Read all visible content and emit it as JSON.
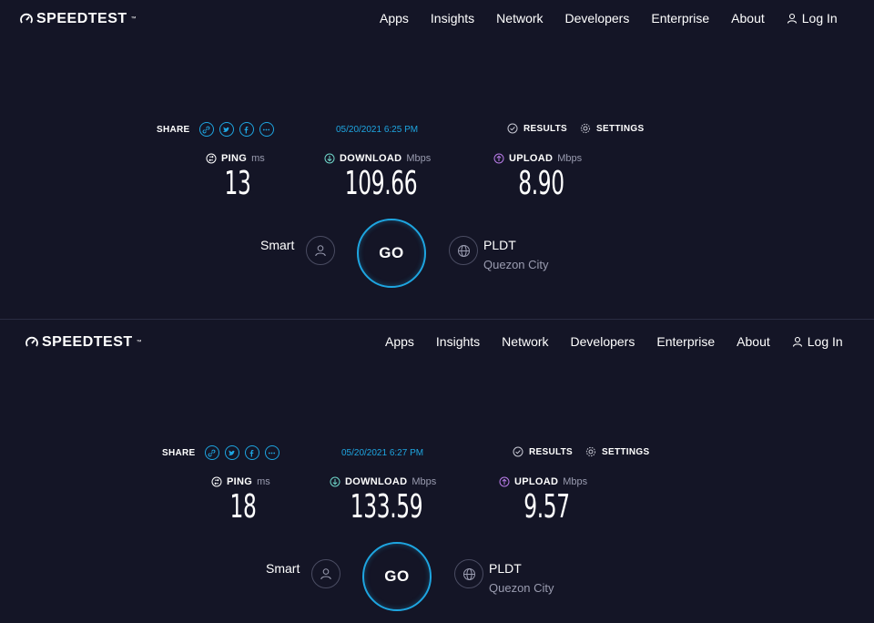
{
  "colors": {
    "background": "#141526",
    "accent_cyan": "#1ea5e0",
    "download_green": "#6fd6c9",
    "upload_purple": "#b97ce8",
    "muted": "#9a9cb0"
  },
  "icons": [
    "speedometer-icon",
    "user-icon",
    "link-icon",
    "twitter-icon",
    "facebook-icon",
    "more-icon",
    "check-circle-icon",
    "gear-icon",
    "ping-icon",
    "download-arrow-icon",
    "upload-arrow-icon",
    "globe-icon"
  ],
  "panels": [
    {
      "header": {
        "logo": "SPEEDTEST",
        "nav": [
          "Apps",
          "Insights",
          "Network",
          "Developers",
          "Enterprise",
          "About"
        ],
        "login": "Log In"
      },
      "share_label": "SHARE",
      "datetime": "05/20/2021 6:25 PM",
      "results_label": "RESULTS",
      "settings_label": "SETTINGS",
      "ping": {
        "label": "PING",
        "unit": "ms",
        "value": "13"
      },
      "download": {
        "label": "DOWNLOAD",
        "unit": "Mbps",
        "value": "109.66"
      },
      "upload": {
        "label": "UPLOAD",
        "unit": "Mbps",
        "value": "8.90"
      },
      "client_isp": "Smart",
      "go_label": "GO",
      "server": {
        "name": "PLDT",
        "location": "Quezon City"
      }
    },
    {
      "header": {
        "logo": "SPEEDTEST",
        "nav": [
          "Apps",
          "Insights",
          "Network",
          "Developers",
          "Enterprise",
          "About"
        ],
        "login": "Log In"
      },
      "share_label": "SHARE",
      "datetime": "05/20/2021 6:27 PM",
      "results_label": "RESULTS",
      "settings_label": "SETTINGS",
      "ping": {
        "label": "PING",
        "unit": "ms",
        "value": "18"
      },
      "download": {
        "label": "DOWNLOAD",
        "unit": "Mbps",
        "value": "133.59"
      },
      "upload": {
        "label": "UPLOAD",
        "unit": "Mbps",
        "value": "9.57"
      },
      "client_isp": "Smart",
      "go_label": "GO",
      "server": {
        "name": "PLDT",
        "location": "Quezon City"
      }
    }
  ]
}
